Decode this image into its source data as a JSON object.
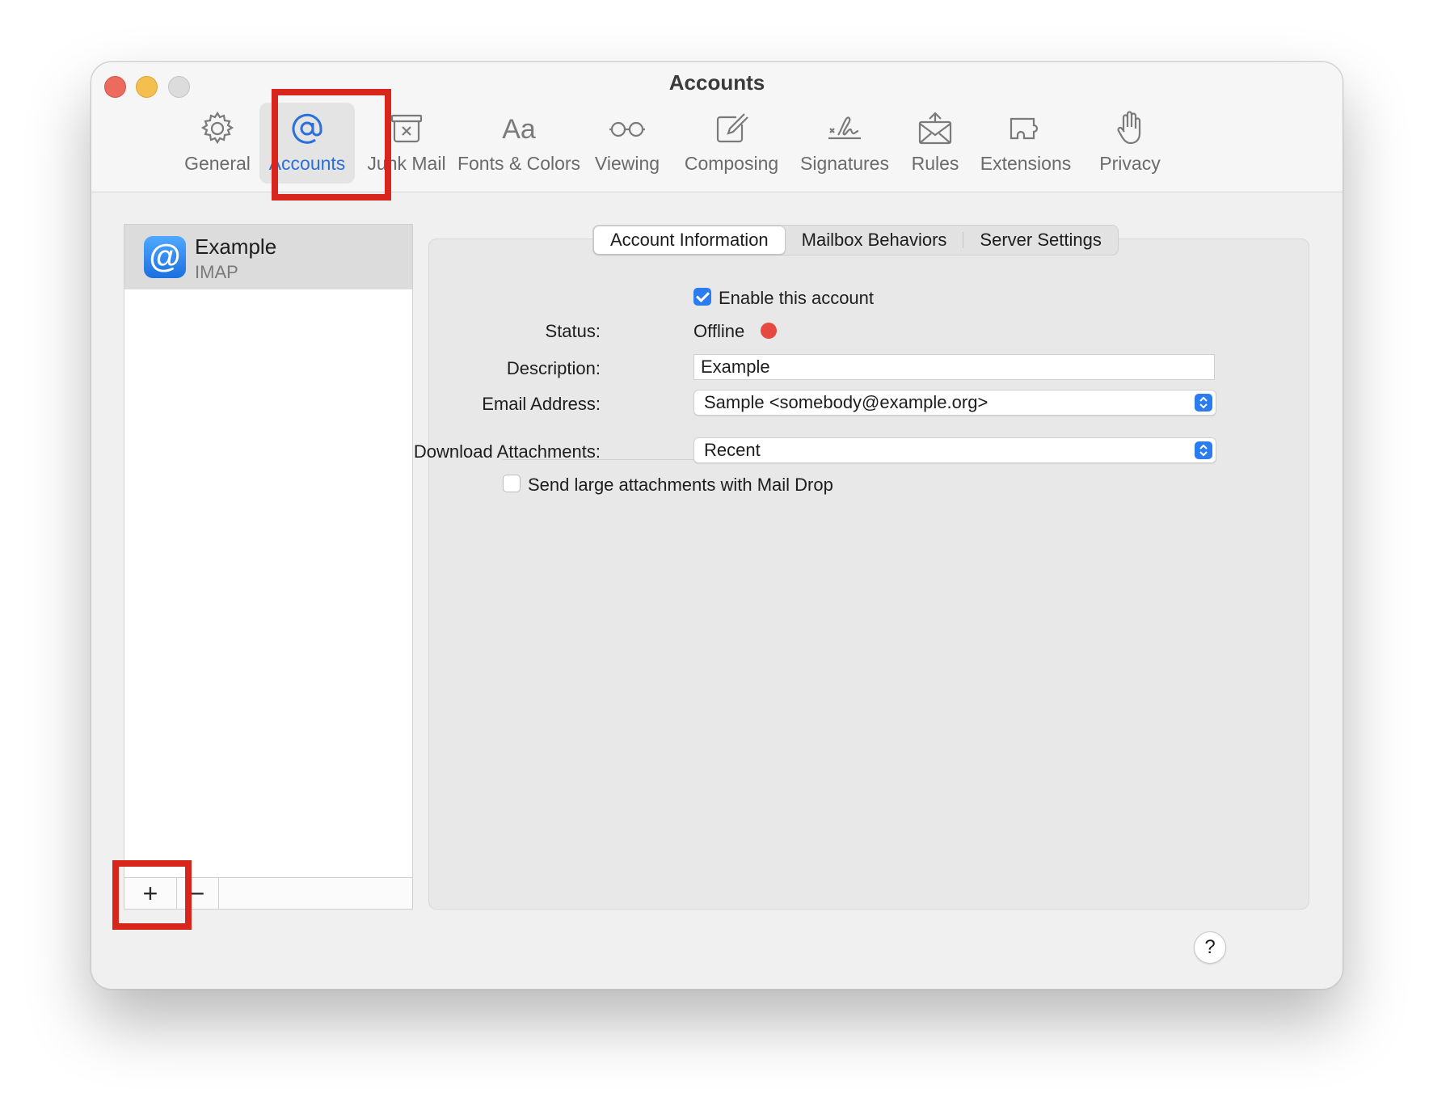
{
  "window": {
    "title": "Accounts"
  },
  "toolbar": {
    "items": [
      {
        "label": "General",
        "icon": "gear-icon"
      },
      {
        "label": "Accounts",
        "icon": "at-sign-icon"
      },
      {
        "label": "Junk Mail",
        "icon": "junk-mail-icon"
      },
      {
        "label": "Fonts & Colors",
        "icon": "fonts-icon"
      },
      {
        "label": "Viewing",
        "icon": "glasses-icon"
      },
      {
        "label": "Composing",
        "icon": "compose-icon"
      },
      {
        "label": "Signatures",
        "icon": "signature-icon"
      },
      {
        "label": "Rules",
        "icon": "rules-icon"
      },
      {
        "label": "Extensions",
        "icon": "puzzle-icon"
      },
      {
        "label": "Privacy",
        "icon": "hand-icon"
      }
    ],
    "active": "Accounts"
  },
  "accounts_list": {
    "items": [
      {
        "name": "Example",
        "type": "IMAP"
      }
    ],
    "add_symbol": "+",
    "remove_symbol": "−"
  },
  "tabs": [
    "Account Information",
    "Mailbox Behaviors",
    "Server Settings"
  ],
  "account_info": {
    "enable_label": "Enable this account",
    "enable_checked": true,
    "status_label": "Status:",
    "status_value": "Offline",
    "description_label": "Description:",
    "description_value": "Example",
    "email_label": "Email Address:",
    "email_value": "Sample <somebody@example.org>",
    "download_label": "Download Attachments:",
    "download_value": "Recent",
    "maildrop_label": "Send large attachments with Mail Drop",
    "maildrop_checked": false
  },
  "help_symbol": "?",
  "colors": {
    "accent": "#2a7cf0",
    "status_offline": "#e5493f",
    "highlight": "#d9261c"
  }
}
